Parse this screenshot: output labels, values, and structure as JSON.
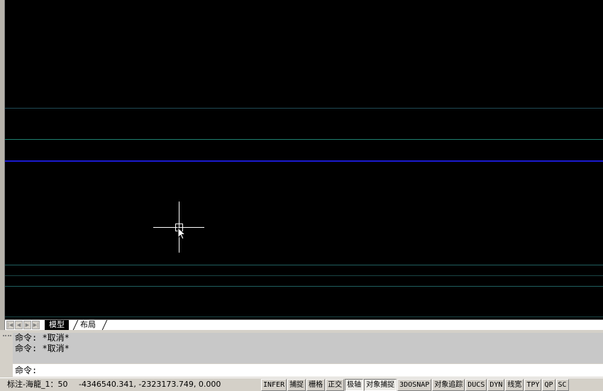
{
  "tabs": [
    {
      "label": "模型",
      "active": true
    },
    {
      "label": "布局",
      "active": false
    }
  ],
  "command": {
    "history": [
      "命令: *取消*",
      "命令: *取消*"
    ],
    "prompt": "命令:"
  },
  "status": {
    "annotation_scale": "标注-海龍_1：50",
    "coordinates": "-4346540.341, -2323173.749, 0.000",
    "toggles": [
      {
        "label": "INFER",
        "on": false
      },
      {
        "label": "捕捉",
        "on": false
      },
      {
        "label": "栅格",
        "on": false
      },
      {
        "label": "正交",
        "on": false
      },
      {
        "label": "极轴",
        "on": true
      },
      {
        "label": "对象捕捉",
        "on": true
      },
      {
        "label": "3DOSNAP",
        "on": false
      },
      {
        "label": "对象追踪",
        "on": false
      },
      {
        "label": "DUCS",
        "on": false
      },
      {
        "label": "DYN",
        "on": false
      },
      {
        "label": "线宽",
        "on": false
      },
      {
        "label": "TPY",
        "on": false
      },
      {
        "label": "QP",
        "on": false
      },
      {
        "label": "SC",
        "on": false
      }
    ]
  },
  "colors": {
    "canvas_bg": "#000000",
    "line_teal": "#1f5f5f",
    "line_green": "#1f7f6f",
    "line_blue": "#1a1aff",
    "crosshair": "#ffffff"
  },
  "icons": [
    "crosshair-cursor",
    "arrow-pointer-icon",
    "first-tab-icon",
    "prev-tab-icon",
    "next-tab-icon",
    "last-tab-icon"
  ]
}
